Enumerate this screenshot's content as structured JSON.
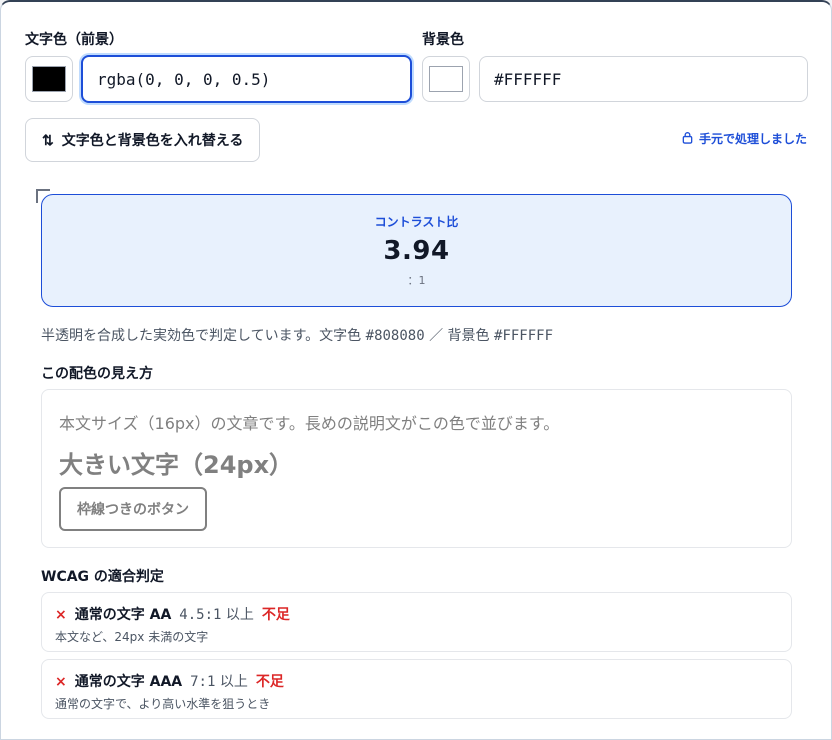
{
  "fg": {
    "label": "文字色（前景）",
    "value": "rgba(0, 0, 0, 0.5)",
    "swatch_color": "#000000"
  },
  "bg": {
    "label": "背景色",
    "value": "#FFFFFF",
    "swatch_color": "#FFFFFF"
  },
  "swap_button": {
    "icon": "⇅",
    "label": "文字色と背景色を入れ替える"
  },
  "local_note": {
    "label": "手元で処理しました"
  },
  "ratio": {
    "label": "コントラスト比",
    "value": "3.94",
    "unit": "：1"
  },
  "note": {
    "prefix": "半透明を合成した実効色で判定しています。文字色 ",
    "fg_hex": "#808080",
    "sep": " ／ 背景色 ",
    "bg_hex": "#FFFFFF"
  },
  "preview": {
    "title": "この配色の見え方",
    "body_text": "本文サイズ（16px）の文章です。長めの説明文がこの色で並びます。",
    "large_text": "大きい文字（24px）",
    "button_label": "枠線つきのボタン",
    "effective_color": "#808080"
  },
  "wcag": {
    "title": "WCAG の適合判定",
    "results": [
      {
        "mark": "×",
        "name": "通常の文字 AA",
        "threshold": "4.5:1",
        "threshold_suffix": " 以上",
        "status": "不足",
        "desc": "本文など、24px 未満の文字"
      },
      {
        "mark": "×",
        "name": "通常の文字 AAA",
        "threshold": "7:1",
        "threshold_suffix": " 以上",
        "status": "不足",
        "desc": "通常の文字で、より高い水準を狙うとき"
      }
    ]
  },
  "colors": {
    "accent": "#1d4ed8",
    "fail": "#dc2626",
    "ratio_bg": "#e8f1fd"
  }
}
